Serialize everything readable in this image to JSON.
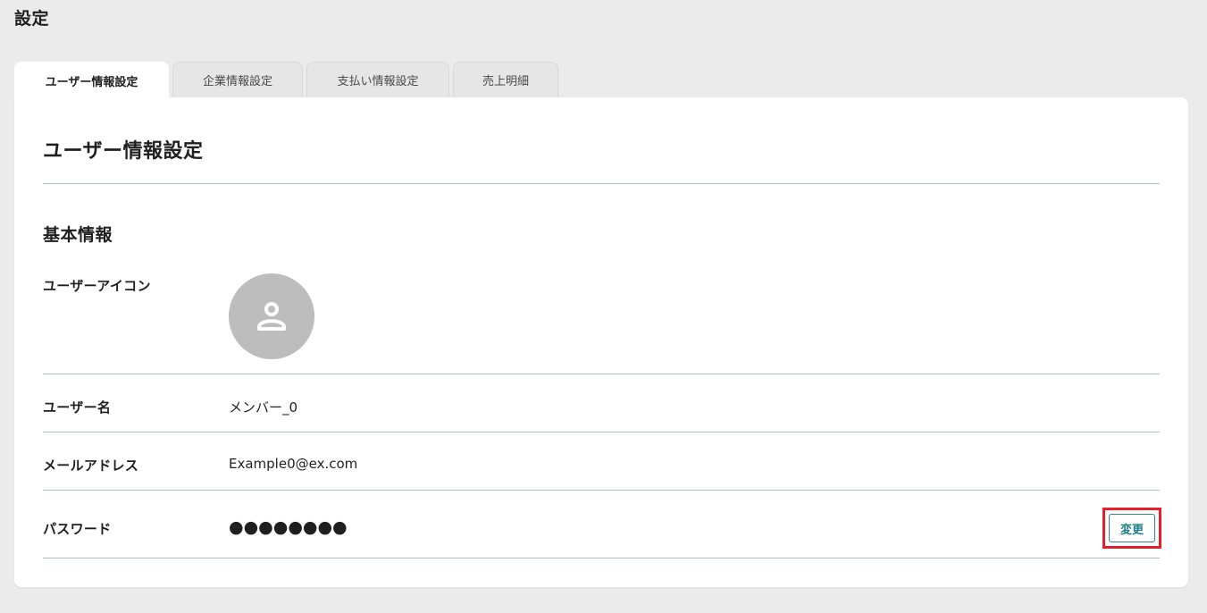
{
  "page": {
    "title": "設定"
  },
  "tabs": [
    {
      "label": "ユーザー情報設定",
      "active": true
    },
    {
      "label": "企業情報設定",
      "active": false
    },
    {
      "label": "支払い情報設定",
      "active": false
    },
    {
      "label": "売上明細",
      "active": false
    }
  ],
  "card": {
    "title": "ユーザー情報設定",
    "section_title": "基本情報"
  },
  "fields": {
    "icon": {
      "label": "ユーザーアイコン",
      "icon": "user-avatar-icon"
    },
    "username": {
      "label": "ユーザー名",
      "value": "メンバー_0"
    },
    "email": {
      "label": "メールアドレス",
      "value": "Example0@ex.com"
    },
    "password": {
      "label": "パスワード",
      "value": "●●●●●●●●",
      "change_label": "変更"
    }
  },
  "colors": {
    "accent": "#1a7f86",
    "highlight": "#e5202a",
    "avatar_bg": "#bdbdbd"
  }
}
